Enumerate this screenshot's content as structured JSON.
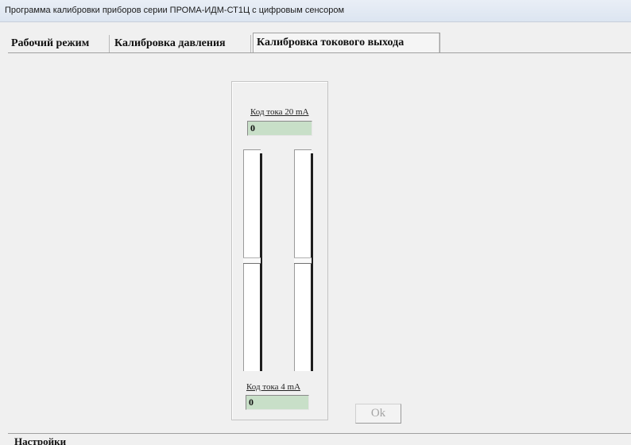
{
  "window": {
    "title": "Программа калибровки приборов серии ПРОМА-ИДМ-СТ1Ц с цифровым сенсором"
  },
  "tabs": [
    {
      "label": "Рабочий режим",
      "active": false
    },
    {
      "label": "Калибровка давления",
      "active": false
    },
    {
      "label": "Калибровка токового выхода",
      "active": true
    }
  ],
  "calibration": {
    "code_20ma_label": "Код тока 20 mA",
    "code_20ma_value": "0",
    "code_4ma_label": "Код тока 4 mA",
    "code_4ma_value": "0",
    "slider_left_level": 0.5,
    "slider_right_level": 0.5
  },
  "ok_button": {
    "label": "Ok",
    "enabled": false
  },
  "footer": {
    "group_label": "Настройки"
  },
  "colors": {
    "field_bg": "#c8dfc8",
    "disabled_text": "#a5a5a5"
  }
}
